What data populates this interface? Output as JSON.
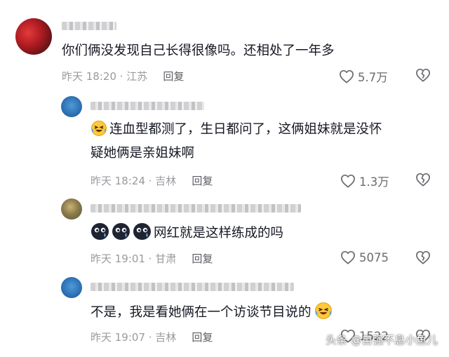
{
  "comments": [
    {
      "text": "你们俩没发现自己长得很像吗。还相处了一年多",
      "time": "昨天 18:20 · 江苏",
      "reply": "回复",
      "likes": "5.7万"
    },
    {
      "text_line1": "连血型都测了，生日都问了，这俩姐妹就是没怀",
      "text_line2": "疑她俩是亲姐妹啊",
      "time": "昨天 18:24 · 吉林",
      "reply": "回复",
      "likes": "1.3万"
    },
    {
      "text": "网红就是这样练成的吗",
      "time": "昨天 19:01 · 甘肃",
      "reply": "回复",
      "likes": "5075"
    },
    {
      "text": "不是，我是看她俩在一个访谈节目说的",
      "time": "昨天 19:07 · 吉林",
      "reply": "回复",
      "likes": "1522"
    }
  ],
  "watermark": "头条 @自强不息小鱼儿",
  "icons": {
    "like": "heart-outline-icon",
    "dislike": "broken-heart-icon",
    "emoji_laugh_cry": "laughing-crying-emoji-icon",
    "emoji_blob": "black-blob-emoji-icon"
  },
  "colors": {
    "text": "#161823",
    "meta": "#9a9aa0",
    "reply": "#5c5c63",
    "icon": "#6b6b72"
  }
}
